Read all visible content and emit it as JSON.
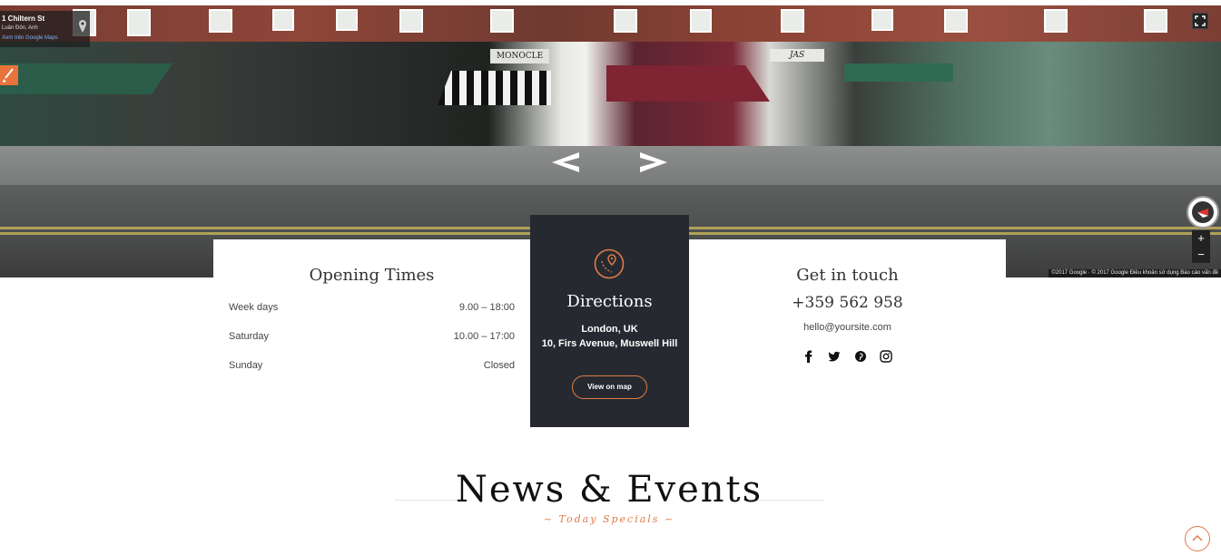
{
  "map": {
    "place_name": "1 Chiltern St",
    "place_location": "Luân Đôn, Anh",
    "view_link": "Xem trên Google Maps",
    "attribution": "©2017 Google · © 2017 Google   Điều khoản sử dụng   Báo cáo vấn đề",
    "zoom_in": "+",
    "zoom_out": "−",
    "storefronts": [
      "MONOCLE",
      "JAS"
    ]
  },
  "hours": {
    "title": "Opening Times",
    "rows": [
      {
        "day": "Week days",
        "time": "9.00 – 18:00"
      },
      {
        "day": "Saturday",
        "time": "10.00 – 17:00"
      },
      {
        "day": "Sunday",
        "time": "Closed"
      }
    ]
  },
  "directions": {
    "title": "Directions",
    "address_line1": "London, UK",
    "address_line2": "10, Firs Avenue, Muswell Hill",
    "button": "View on map",
    "accent_color": "#e07a4a"
  },
  "contact": {
    "title": "Get in touch",
    "phone": "+359 562 958",
    "email": "hello@yoursite.com",
    "social": [
      "facebook-icon",
      "twitter-icon",
      "pinterest-icon",
      "instagram-icon"
    ]
  },
  "news": {
    "title": "News & Events",
    "subtitle": "~ Today Specials ~"
  }
}
